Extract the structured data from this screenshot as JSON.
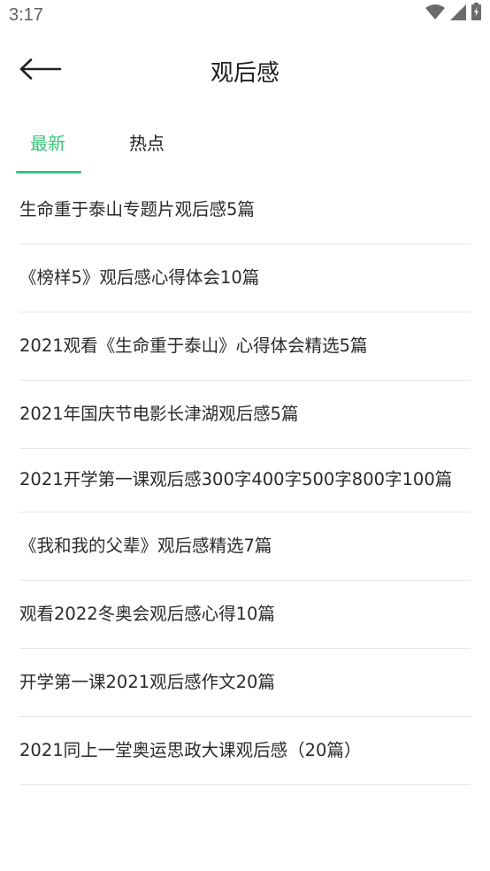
{
  "status_bar": {
    "time": "3:17",
    "icons": [
      "wifi-icon",
      "signal-icon",
      "battery-charging-icon"
    ]
  },
  "header": {
    "title": "观后感",
    "back_icon": "arrow-left-icon"
  },
  "tabs": [
    {
      "label": "最新",
      "active": true
    },
    {
      "label": "热点",
      "active": false
    }
  ],
  "colors": {
    "accent": "#3cc47c",
    "text": "#222222",
    "divider": "#e6e6e6"
  },
  "articles": [
    "生命重于泰山专题片观后感5篇",
    "《榜样5》观后感心得体会10篇",
    "2021观看《生命重于泰山》心得体会精选5篇",
    "2021年国庆节电影长津湖观后感5篇",
    "2021开学第一课观后感300字400字500字800字100篇",
    "《我和我的父辈》观后感精选7篇",
    "观看2022冬奥会观后感心得10篇",
    "开学第一课2021观后感作文20篇",
    "2021同上一堂奥运思政大课观后感（20篇）"
  ]
}
